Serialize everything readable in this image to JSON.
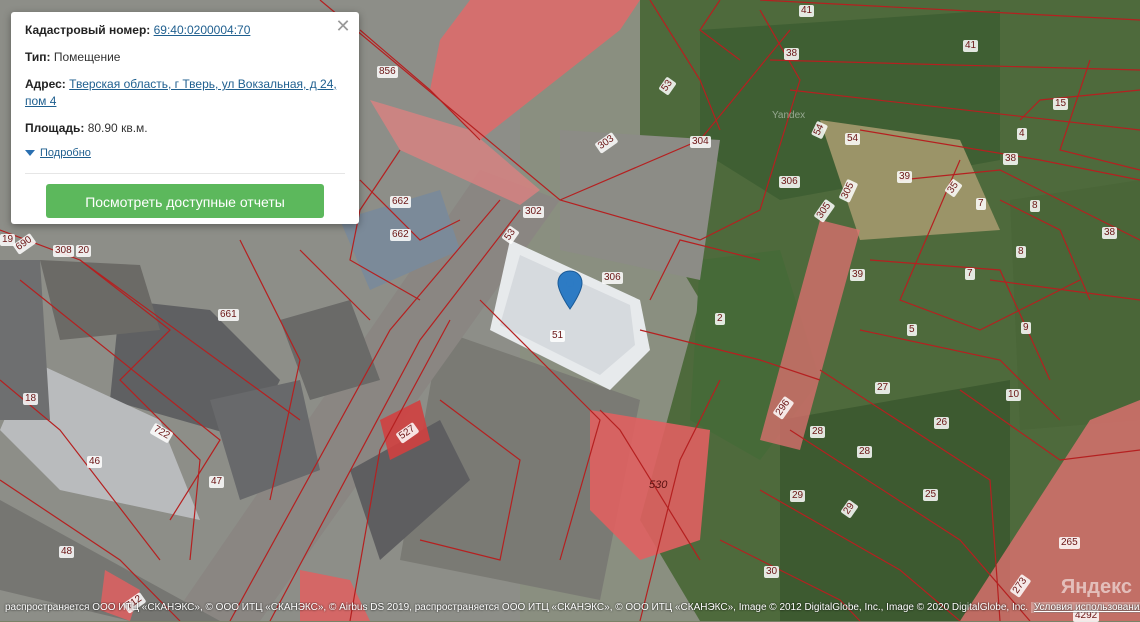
{
  "popup": {
    "cadastral_label": "Кадастровый номер:",
    "cadastral_number": "69:40:0200004:70",
    "type_label": "Тип:",
    "type_value": "Помещение",
    "address_label": "Адрес:",
    "address_value": "Тверская область, г Тверь, ул Вокзальная, д 24, пом 4",
    "area_label": "Площадь:",
    "area_value": "80.90 кв.м.",
    "details_link": "Подробно",
    "button_label": "Посмотреть доступные отчеты",
    "close_icon": "close-icon"
  },
  "map": {
    "watermark_center": "Yandex",
    "logo": "Яндекс",
    "attribution": "распространяется ООО ИТЦ «СКАНЭКС», © ООО ИТЦ «СКАНЭКС», © Airbus DS 2019, распространяется ООО ИТЦ «СКАНЭКС», © ООО ИТЦ «СКАНЭКС», Image © 2012 DigitalGlobe, Inc., Image © 2020 DigitalGlobe, Inc.",
    "terms_link": "Условия использования",
    "parcel_labels": [
      "41",
      "41",
      "38",
      "856",
      "53",
      "15",
      "4",
      "303",
      "304",
      "54",
      "54",
      "38",
      "39",
      "306",
      "35",
      "7",
      "8",
      "305",
      "305",
      "302",
      "662",
      "53",
      "306",
      "8",
      "38",
      "19",
      "690",
      "308",
      "20",
      "662",
      "39",
      "7",
      "661",
      "2",
      "5",
      "9",
      "51",
      "27",
      "10",
      "296",
      "527",
      "722",
      "18",
      "28",
      "26",
      "46",
      "28",
      "47",
      "530",
      "29",
      "25",
      "29",
      "48",
      "265",
      "30",
      "712",
      "273",
      "4292"
    ]
  },
  "colors": {
    "parcel_fill": "#e05a5a",
    "parcel_line": "#b02020",
    "button": "#5cb85c",
    "link": "#1f5f8f",
    "marker": "#2d7bc4"
  }
}
